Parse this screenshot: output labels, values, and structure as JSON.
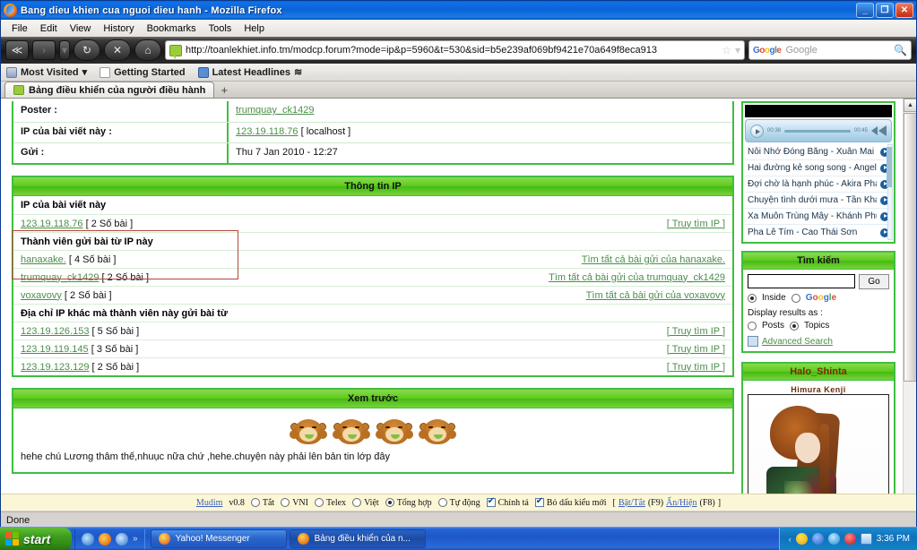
{
  "window": {
    "title": "Bang dieu khien cua nguoi dieu hanh - Mozilla Firefox",
    "minimize": "_",
    "maximize": "❐",
    "close": "✕"
  },
  "menubar": [
    "File",
    "Edit",
    "View",
    "History",
    "Bookmarks",
    "Tools",
    "Help"
  ],
  "navbar": {
    "back": "≪",
    "forward": "›",
    "dropdown": "▾",
    "reload": "↻",
    "stop": "✕",
    "home": "⌂",
    "url": "http://toanlekhiet.info.tm/modcp.forum?mode=ip&p=5960&t=530&sid=b5e239af069bf9421e70a649f8eca913",
    "star": "☆",
    "url_dropdown": "▾",
    "search_placeholder": "Google",
    "search_icon": "ὐD"
  },
  "bookmarks": [
    {
      "label": "Most Visited",
      "icon": "folder-icon",
      "caret": "▾"
    },
    {
      "label": "Getting Started",
      "icon": "document-icon",
      "caret": ""
    },
    {
      "label": "Latest Headlines",
      "icon": "feed-icon",
      "caret": "≋"
    }
  ],
  "tabs": {
    "active_tab": "Bảng điều khiển của người điều hành",
    "new_tab": "+"
  },
  "post_info": {
    "rows": [
      {
        "label": "Poster :",
        "value": "trumquay_ck1429",
        "is_link": true
      },
      {
        "label": "IP của bài viết này :",
        "value": "123.19.118.76",
        "suffix": "[ localhost ]",
        "is_link": true
      },
      {
        "label": "Gửi :",
        "value": "Thu 7 Jan 2010 - 12:27",
        "is_link": false
      }
    ]
  },
  "ip_info": {
    "header": "Thông tin IP",
    "section1_title": "IP của bài viết này",
    "section1_rows": [
      {
        "ip": "123.19.118.76",
        "count": "[ 2 Số bài ]",
        "action": "[ Truy tìm IP ]"
      }
    ],
    "section2_title": "Thành viên gửi bài từ IP này",
    "section2_rows": [
      {
        "user": "hanaxake.",
        "count": "[ 4 Số bài ]",
        "action": "Tìm tất cả bài gửi của hanaxake."
      },
      {
        "user": "trumquay_ck1429",
        "count": "[ 2 Số bài ]",
        "action": "Tìm tất cả bài gửi của trumquay_ck1429"
      },
      {
        "user": "voxavovy",
        "count": "[ 2 Số bài ]",
        "action": "Tìm tất cả bài gửi của voxavovy"
      }
    ],
    "section3_title": "Địa chỉ IP khác mà thành viên này gửi bài từ",
    "section3_rows": [
      {
        "ip": "123.19.126.153",
        "count": "[ 5 Số bài ]",
        "action": "[ Truy tìm IP ]"
      },
      {
        "ip": "123.19.119.145",
        "count": "[ 3 Số bài ]",
        "action": "[ Truy tìm IP ]"
      },
      {
        "ip": "123.19.123.129",
        "count": "[ 2 Số bài ]",
        "action": "[ Truy tìm IP ]"
      }
    ]
  },
  "preview": {
    "header": "Xem trước",
    "text": "hehe chú Lương thâm thế,nhuục nữa chứ ,hehe.chuyện này phải lên bản tin lớp đây",
    "emoticons": [
      "monkey-emoticon",
      "monkey-emoticon",
      "monkey-emoticon",
      "monkey-emoticon"
    ]
  },
  "player": {
    "time_current": "00:38",
    "time_total": "00:45",
    "play_icon": "play-icon",
    "volume_icon": "volume-icon",
    "playlist": [
      {
        "title": "Nỗi Nhớ Đóng Băng - Xuân Mai f"
      },
      {
        "title": "Hai đường kẻ song song - Angel"
      },
      {
        "title": "Đợi chờ là hạnh phúc - Akira Phạ"
      },
      {
        "title": "Chuyện tình dưới mưa - Tần Khá"
      },
      {
        "title": "Xa Muôn Trùng Mây - Khánh Phư"
      },
      {
        "title": "Pha Lê Tím - Cao Thái Sơn"
      }
    ]
  },
  "search_widget": {
    "header": "Tìm kiếm",
    "input_value": "",
    "go_label": "Go",
    "scope_options": [
      {
        "label": "Inside",
        "selected": true
      },
      {
        "label": "Google",
        "selected": false,
        "brand": true
      }
    ],
    "display_label": "Display results as :",
    "display_options": [
      {
        "label": "Posts",
        "selected": false
      },
      {
        "label": "Topics",
        "selected": true
      }
    ],
    "advanced_label": "Advanced Search"
  },
  "avatar_box": {
    "header": "Halo_Shinta",
    "signature": "Himura Kenji"
  },
  "mudim": {
    "brand": "Mudim",
    "version": "v0.8",
    "modes": [
      {
        "label": "Tắt",
        "selected": false
      },
      {
        "label": "VNI",
        "selected": false
      },
      {
        "label": "Telex",
        "selected": false
      },
      {
        "label": "Việt",
        "selected": false
      },
      {
        "label": "Tổng hợp",
        "selected": true
      },
      {
        "label": "Tự động",
        "selected": false
      }
    ],
    "checkboxes": [
      {
        "label": "Chính tả",
        "checked": true
      },
      {
        "label": "Bỏ dấu kiểu mới",
        "checked": true
      }
    ],
    "toggle_open": "[",
    "toggle_link": "Bật/Tắt",
    "toggle_key": "(F9)",
    "hide_link": "Ẩn/Hiện",
    "hide_key": "(F8)",
    "toggle_close": "]"
  },
  "statusbar": {
    "text": "Done"
  },
  "taskbar": {
    "start_label": "start",
    "quicklaunch_more": "»",
    "tasks": [
      {
        "label": "Yahoo! Messenger",
        "icon": "yahoo-icon",
        "active": false
      },
      {
        "label": "Bảng điều khiển của n...",
        "icon": "firefox-icon",
        "active": true
      }
    ],
    "tray_arrow": "‹",
    "clock": "3:36 PM"
  },
  "scrollbar": {
    "up": "▲",
    "down": "▼"
  },
  "colors": {
    "green_border": "#3fbf3f",
    "green_header": "#5ecb1e",
    "link": "#4a8f4a",
    "red_highlight": "#b5463b",
    "titlebar_blue": "#0b62d6"
  }
}
